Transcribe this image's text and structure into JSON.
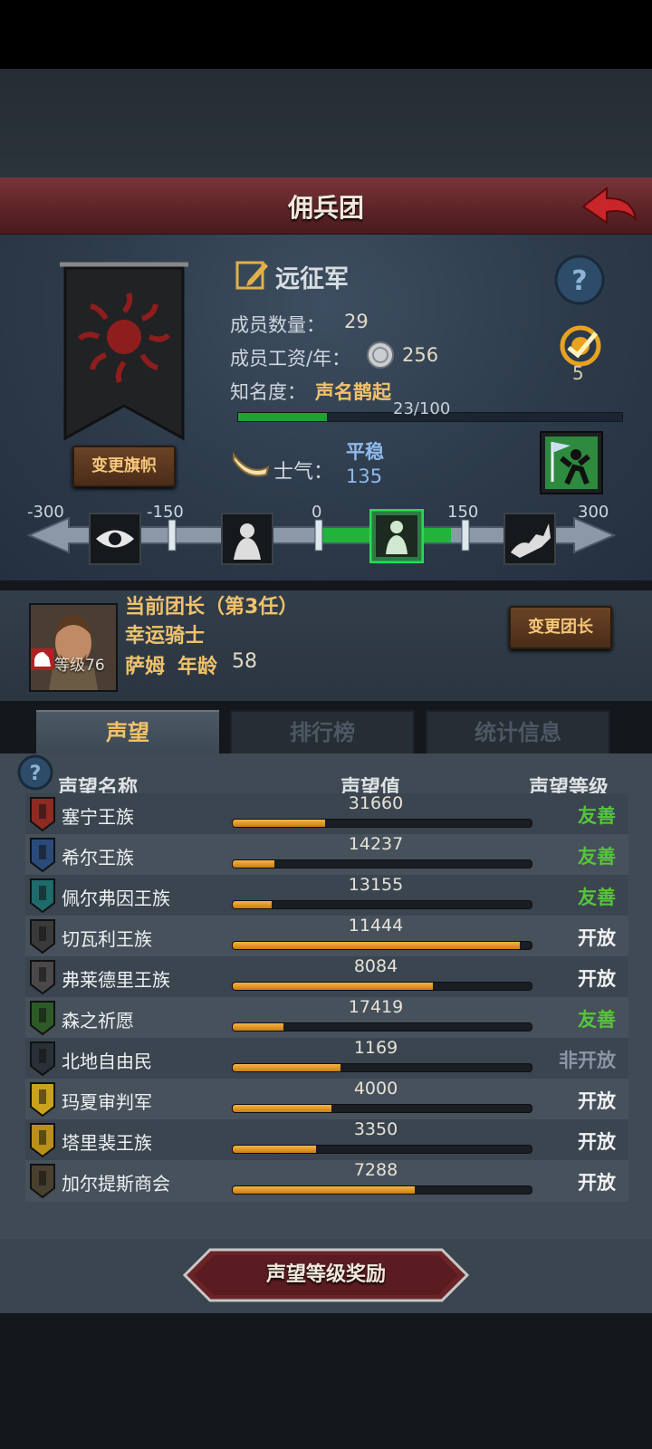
{
  "header": {
    "title": "佣兵团"
  },
  "company": {
    "name": "远征军",
    "members_label": "成员数量：",
    "members_value": "29",
    "wage_label": "成员工资/年：",
    "wage_value": "256",
    "fame_label": "知名度：",
    "fame_value": "声名鹊起",
    "fame_progress_text": "23/100",
    "fame_progress": 0.23,
    "change_banner_label": "变更旗帜",
    "badge_count": "5"
  },
  "morale": {
    "label": "士气：",
    "state": "平稳",
    "value": "135",
    "ticks": [
      "-300",
      "-150",
      "0",
      "150",
      "300"
    ]
  },
  "leader": {
    "title": "当前团长（第3任）",
    "trait": "幸运骑士",
    "name": "萨姆",
    "age_label": "年龄",
    "age_value": "58",
    "level_text": "等级76",
    "change_leader_label": "变更团长"
  },
  "tabs": [
    {
      "label": "声望"
    },
    {
      "label": "排行榜"
    },
    {
      "label": "统计信息"
    }
  ],
  "reputation": {
    "col_name": "声望名称",
    "col_value": "声望值",
    "col_level": "声望等级",
    "rows": [
      {
        "name": "塞宁王族",
        "value": "31660",
        "fill": 0.31,
        "level": "友善",
        "level_color": "#55c53a",
        "crest_color": "#8e2a22"
      },
      {
        "name": "希尔王族",
        "value": "14237",
        "fill": 0.14,
        "level": "友善",
        "level_color": "#55c53a",
        "crest_color": "#2a4a7a"
      },
      {
        "name": "佩尔弗因王族",
        "value": "13155",
        "fill": 0.13,
        "level": "友善",
        "level_color": "#55c53a",
        "crest_color": "#1f6a6a"
      },
      {
        "name": "切瓦利王族",
        "value": "11444",
        "fill": 0.96,
        "level": "开放",
        "level_color": "#f2f2f2",
        "crest_color": "#3a3a3a"
      },
      {
        "name": "弗莱德里王族",
        "value": "8084",
        "fill": 0.67,
        "level": "开放",
        "level_color": "#f2f2f2",
        "crest_color": "#4a4848"
      },
      {
        "name": "森之祈愿",
        "value": "17419",
        "fill": 0.17,
        "level": "友善",
        "level_color": "#55c53a",
        "crest_color": "#2d5a26"
      },
      {
        "name": "北地自由民",
        "value": "1169",
        "fill": 0.36,
        "level": "非开放",
        "level_color": "#8a96a6",
        "crest_color": "#2a3038"
      },
      {
        "name": "玛夏审判军",
        "value": "4000",
        "fill": 0.33,
        "level": "开放",
        "level_color": "#f2f2f2",
        "crest_color": "#c9a21e"
      },
      {
        "name": "塔里裴王族",
        "value": "3350",
        "fill": 0.28,
        "level": "开放",
        "level_color": "#f2f2f2",
        "crest_color": "#b8901a"
      },
      {
        "name": "加尔提斯商会",
        "value": "7288",
        "fill": 0.61,
        "level": "开放",
        "level_color": "#f2f2f2",
        "crest_color": "#4a4030"
      }
    ]
  },
  "footer": {
    "reward_button": "声望等级奖励"
  }
}
